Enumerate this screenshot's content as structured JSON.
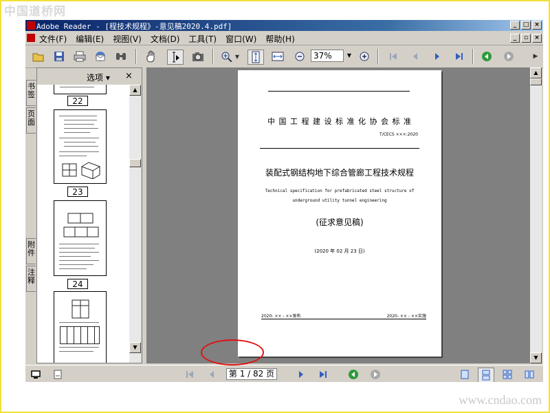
{
  "watermark_top": "中国道桥网",
  "watermark_bottom": "www.cndao.com",
  "window": {
    "title": "Adobe Reader - [程技术规程》-意见稿2020.4.pdf]",
    "btn_min": "_",
    "btn_max": "□",
    "btn_close": "×",
    "doc_btn_min": "_",
    "doc_btn_restore": "▫",
    "doc_btn_close": "×"
  },
  "menu": [
    "文件(F)",
    "编辑(E)",
    "视图(V)",
    "文档(D)",
    "工具(T)",
    "窗口(W)",
    "帮助(H)"
  ],
  "toolbar": {
    "zoom_value": "37%",
    "icons": [
      "open-icon",
      "save-icon",
      "print-icon",
      "email-icon",
      "search-icon",
      "hand-tool-icon",
      "select-text-icon",
      "snapshot-icon",
      "zoom-in-tool-icon",
      "fit-page-icon",
      "fit-width-icon",
      "zoom-out-icon",
      "zoom-in-icon",
      "first-page-icon",
      "prev-page-icon",
      "next-page-icon",
      "last-page-icon",
      "go-back-icon",
      "go-forward-icon"
    ]
  },
  "nav_tabs": {
    "bookmarks": "书签",
    "pages": "页面",
    "attachments": "附件",
    "comments": "注释"
  },
  "panel": {
    "options_label": "选项",
    "options_arrow": "▾",
    "close": "×",
    "page_numbers": [
      "22",
      "23",
      "24"
    ]
  },
  "document": {
    "standard_header": "中 国 工 程 建 设 标 准 化 协 会 标 准",
    "standard_number": "T/CECS  ×××:2020",
    "title_cn": "装配式钢结构地下综合管廊工程技术规程",
    "title_en_line1": "Technical specification for prefabricated steel structure of",
    "title_en_line2": "underground utility tunnel engineering",
    "draft_label": "(征求意见稿)",
    "date": "(2020 年 02 月 23 日)",
    "issue_date": "2020- ×× - ××发布",
    "effective_date": "2020- ×× - ××实施"
  },
  "status": {
    "page_indicator": "第 1 / 82 页"
  }
}
